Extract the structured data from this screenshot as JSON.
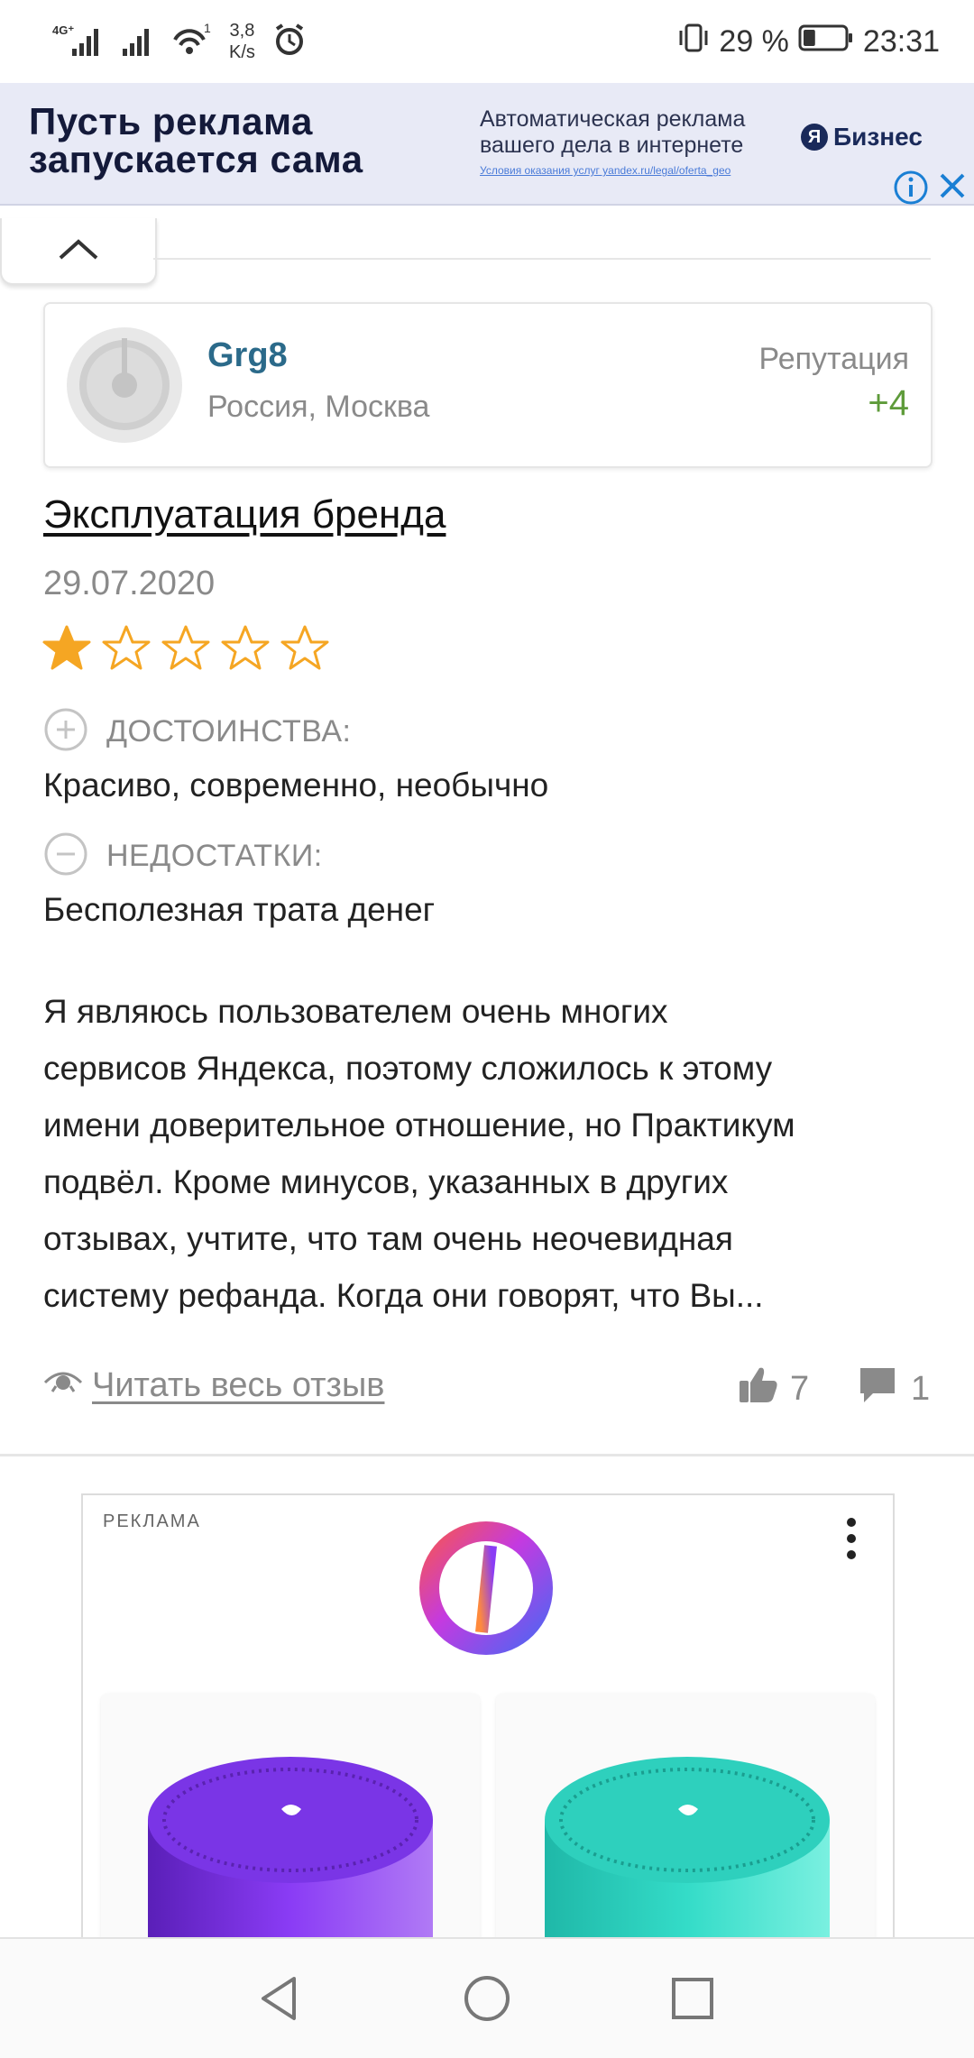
{
  "status_bar": {
    "network": "4G⁺",
    "speed": "3,8\nK/s",
    "speed_value": "3,8",
    "speed_unit": "K/s",
    "wifi_badge": "1",
    "battery_percent": "29 %",
    "time": "23:31",
    "battery_level": 0.29
  },
  "top_ad": {
    "headline_line1": "Пусть реклама",
    "headline_line2": "запускается сама",
    "desc_line1": "Автоматическая реклама",
    "desc_line2": "вашего дела в интернете",
    "fine_print": "Условия оказания услуг yandex.ru/legal/oferta_geo",
    "brand_letter": "Я",
    "brand_name": "Бизнес",
    "info_icon": "info-icon",
    "close_icon": "close-icon"
  },
  "author": {
    "username": "Grg8",
    "location": "Россия, Москва",
    "reputation_label": "Репутация",
    "reputation_value": "+4"
  },
  "review": {
    "title": "Эксплуатация бренда",
    "date": "29.07.2020",
    "rating": 1,
    "rating_max": 5,
    "pros_label": "ДОСТОИНСТВА:",
    "pros_text": "Красиво, современно, необычно",
    "cons_label": "НЕДОСТАТКИ:",
    "cons_text": "Бесполезная трата денег",
    "body_lines": [
      "Я являюсь пользователем очень многих",
      "сервисов Яндекса, поэтому сложилось к этому",
      "имени доверительное отношение, но Практикум",
      "подвёл. Кроме минусов, указанных в других",
      "отзывах, учтите, что там очень неочевидная",
      "систему рефанда. Когда они говорят, что Вы..."
    ],
    "read_full": "Читать весь отзыв",
    "likes": "7",
    "comments": "1"
  },
  "bottom_ad": {
    "label": "РЕКЛАМА",
    "products": [
      {
        "name": "purple-smart-speaker",
        "color": "#7b2fe0"
      },
      {
        "name": "teal-smart-speaker",
        "color": "#2fd6c3"
      }
    ]
  },
  "colors": {
    "star": "#f5a623",
    "username": "#2b6a8a",
    "reputation": "#5e9b3a",
    "muted": "#8a8a8a"
  }
}
